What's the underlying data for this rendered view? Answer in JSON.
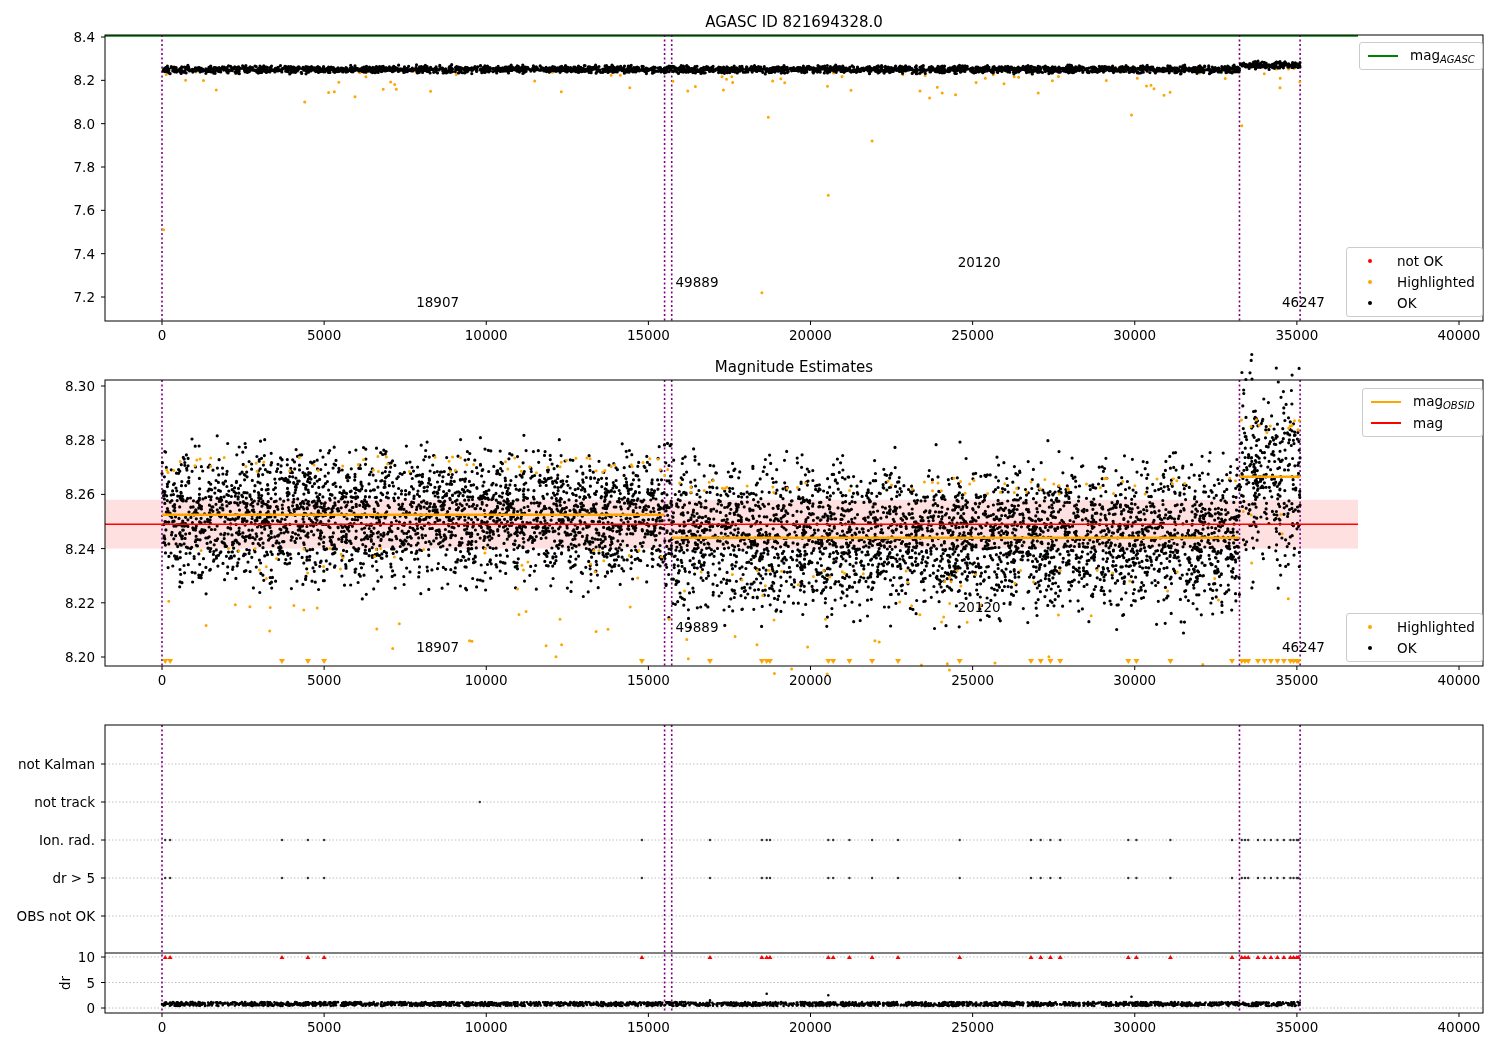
{
  "panels": [
    {
      "kind": "agasc",
      "title": "AGASC ID 821694328.0",
      "yticks": [
        "8.4",
        "8.2",
        "8.0",
        "7.8",
        "7.6",
        "7.4",
        "7.2"
      ],
      "xticks": [
        "0",
        "5000",
        "10000",
        "15000",
        "20000",
        "25000",
        "30000",
        "35000",
        "40000"
      ],
      "obsids": [
        {
          "label": "18907"
        },
        {
          "label": "49889"
        },
        {
          "label": "20120"
        },
        {
          "label": "46247"
        }
      ],
      "legends": [
        {
          "entries": [
            {
              "kind": "line",
              "label": "mag$_{AGASC}$",
              "color": "#008000"
            }
          ]
        },
        {
          "entries": [
            {
              "kind": "dot",
              "label": "not OK",
              "color": "#ff0000"
            },
            {
              "kind": "dot",
              "label": "Highlighted",
              "color": "#ffa500"
            },
            {
              "kind": "dot",
              "label": "OK",
              "color": "#000000"
            }
          ]
        }
      ]
    },
    {
      "kind": "estimates",
      "title": "Magnitude Estimates",
      "yticks": [
        "8.30",
        "8.28",
        "8.26",
        "8.24",
        "8.22",
        "8.20"
      ],
      "xticks": [
        "0",
        "5000",
        "10000",
        "15000",
        "20000",
        "25000",
        "30000",
        "35000",
        "40000"
      ],
      "obsids": [
        {
          "label": "18907"
        },
        {
          "label": "49889"
        },
        {
          "label": "20120"
        },
        {
          "label": "46247"
        }
      ],
      "legends": [
        {
          "entries": [
            {
              "kind": "line",
              "label": "mag$_{OBSID}$",
              "color": "#ffa500"
            },
            {
              "kind": "line",
              "label": "mag",
              "color": "#ff0000"
            }
          ]
        },
        {
          "entries": [
            {
              "kind": "dot",
              "label": "Highlighted",
              "color": "#ffa500"
            },
            {
              "kind": "dot",
              "label": "OK",
              "color": "#000000"
            }
          ]
        }
      ]
    },
    {
      "kind": "flags",
      "rows": [
        "not Kalman",
        "not track",
        "Ion. rad.",
        "dr > 5",
        "OBS not OK"
      ],
      "ylabel": "dr",
      "yticks": [
        "10",
        "5",
        "0"
      ],
      "xticks": [
        "0",
        "5000",
        "10000",
        "15000",
        "20000",
        "25000",
        "30000",
        "35000",
        "40000"
      ]
    }
  ]
}
